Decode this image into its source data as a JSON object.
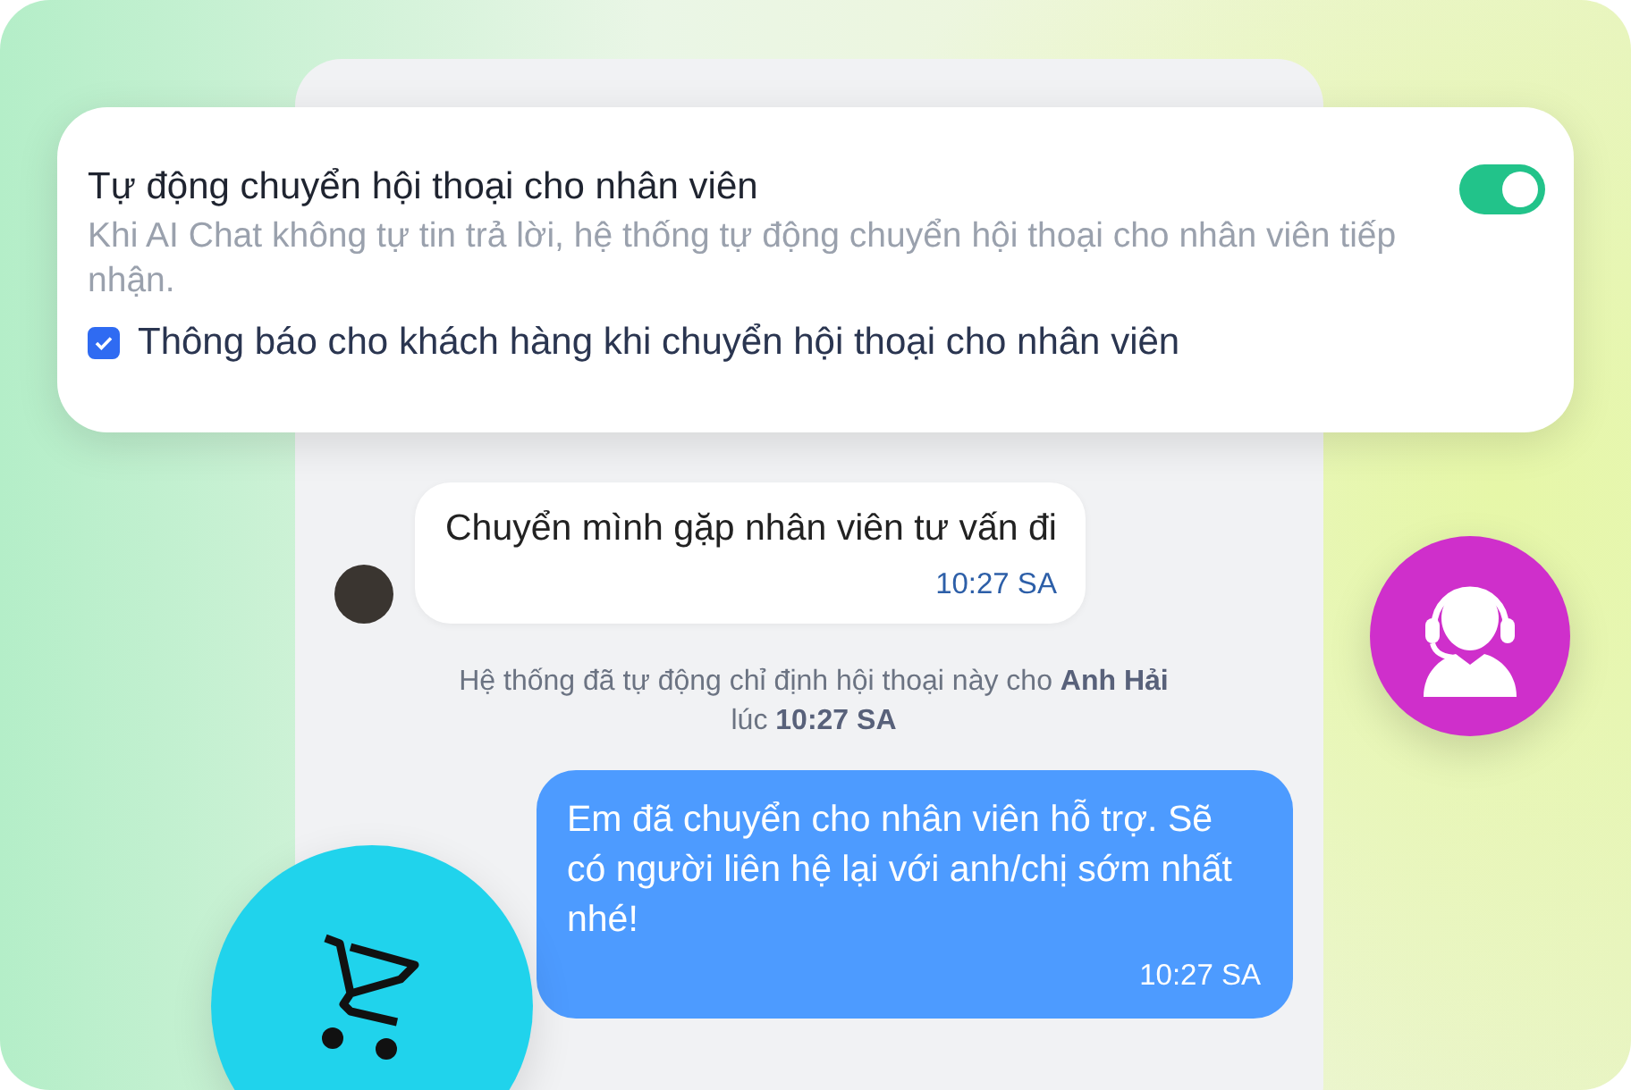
{
  "settings": {
    "title": "Tự động chuyển hội thoại cho nhân viên",
    "description": "Khi AI Chat không tự tin trả lời, hệ thống tự động chuyển hội thoại cho nhân viên tiếp nhận.",
    "on": true,
    "notify": {
      "label": "Thông báo cho khách hàng khi chuyển hội thoại cho nhân viên",
      "checked": true
    }
  },
  "messages": [
    {
      "kind": "incoming",
      "text": "Chuyển mình gặp nhân viên tư vấn đi",
      "time": "10:27 SA"
    },
    {
      "kind": "system",
      "text": "Hệ thống đã tự động chỉ định hội thoại này cho **Anh Hải** lúc **10:27 SA**"
    },
    {
      "kind": "outgoing",
      "text": "Em đã chuyển cho nhân viên hỗ trợ. Sẽ có người liên hệ lại với anh/chị sớm nhất nhé!",
      "time": "10:27 SA"
    }
  ]
}
